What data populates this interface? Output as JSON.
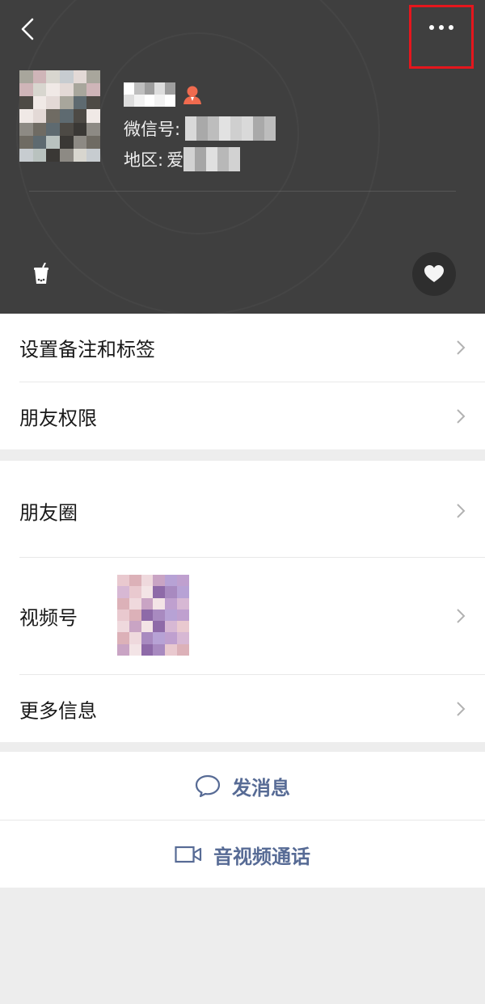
{
  "header": {
    "wechat_id_label": "微信号:",
    "region_label": "地区:",
    "region_value_visible": "爱"
  },
  "colors": {
    "header_bg": "#3f3f3f",
    "link_blue": "#576b95",
    "highlight_red": "#e5161d",
    "gender_icon": "#f06b4f"
  },
  "icons": {
    "back": "chevron-left-icon",
    "more": "more-dots-icon",
    "gender": "person-icon",
    "cup": "milk-tea-cup-icon",
    "heart": "heart-icon",
    "chevron": "chevron-right-icon",
    "chat": "chat-bubble-icon",
    "video_call": "video-camera-icon"
  },
  "list": {
    "remark_tags": "设置备注和标签",
    "friend_permissions": "朋友权限",
    "moments": "朋友圈",
    "channels": "视频号",
    "more_info": "更多信息"
  },
  "actions": {
    "send_message": "发消息",
    "voice_video_call": "音视频通话"
  }
}
